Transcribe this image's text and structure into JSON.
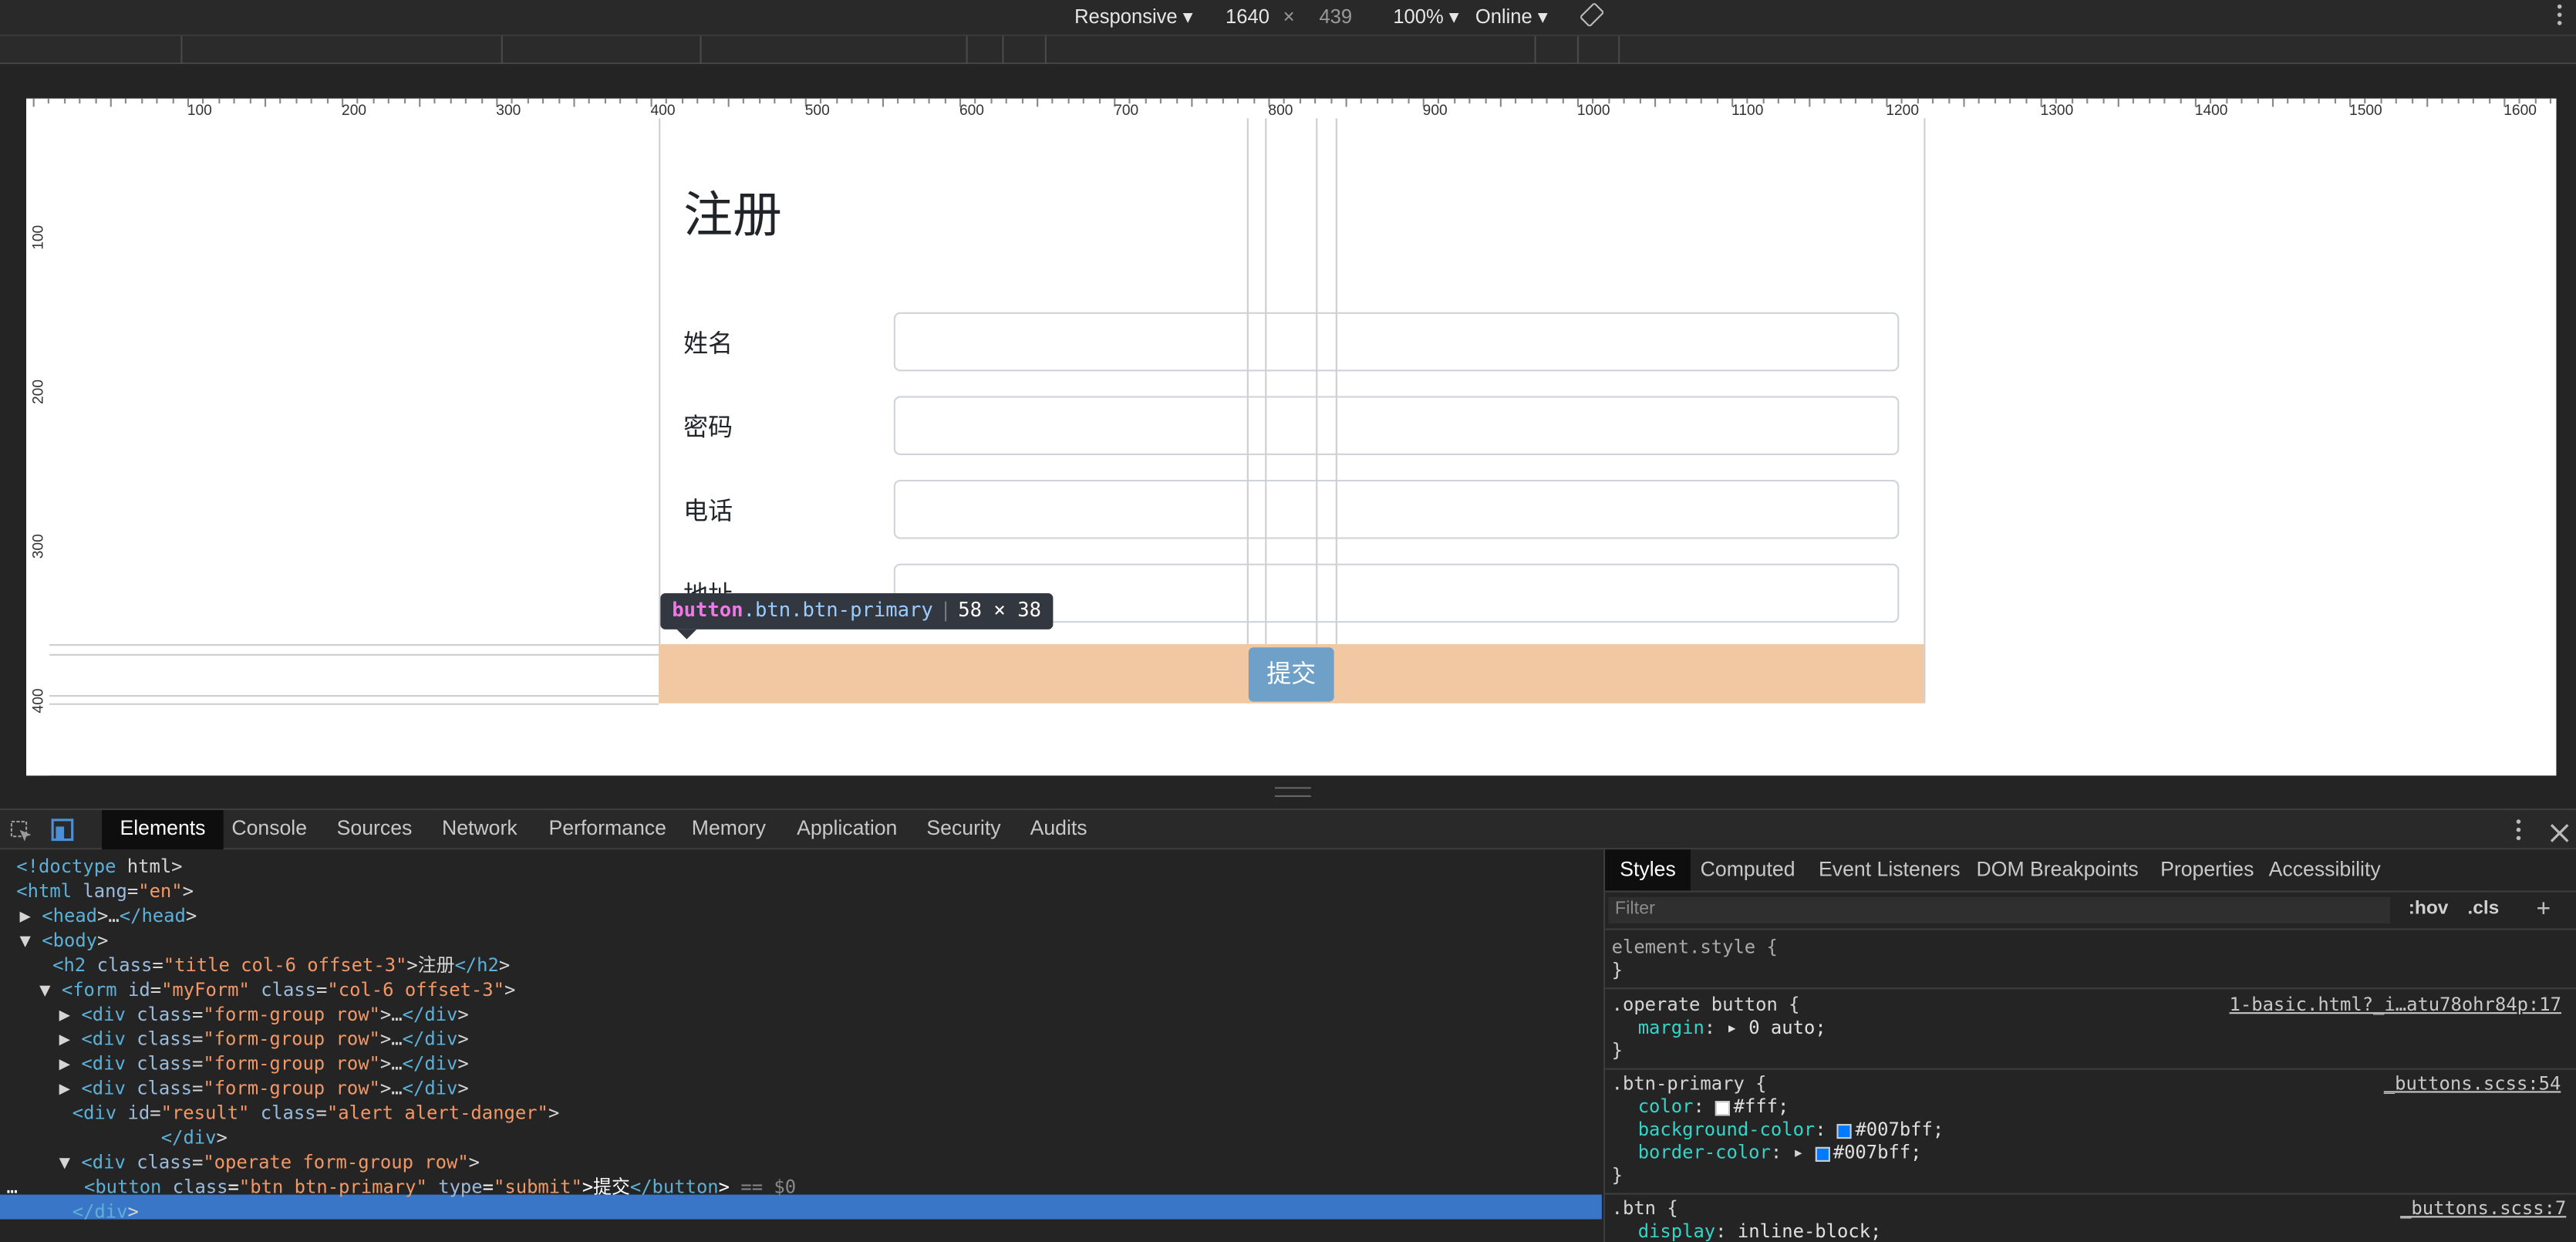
{
  "toolbar": {
    "device": "Responsive ▾",
    "width": "1640",
    "times": "×",
    "height": "439",
    "zoom": "100% ▾",
    "throttle": "Online ▾"
  },
  "ruler": {
    "h_labels": [
      "100",
      "200",
      "300",
      "400",
      "500",
      "600",
      "700",
      "800",
      "900",
      "1000",
      "1100",
      "1200",
      "1300",
      "1400",
      "1500",
      "1600"
    ],
    "v_labels": [
      "100",
      "200",
      "300",
      "400"
    ]
  },
  "page": {
    "title": "注册",
    "fields": [
      {
        "label": "姓名",
        "value": ""
      },
      {
        "label": "密码",
        "value": ""
      },
      {
        "label": "电话",
        "value": ""
      },
      {
        "label": "地址",
        "value": ""
      }
    ],
    "submit_label": "提交"
  },
  "tooltip": {
    "tag": "button",
    "classes": ".btn.btn-primary",
    "separator": "|",
    "size": "58 × 38"
  },
  "devtools": {
    "tabs": [
      "Elements",
      "Console",
      "Sources",
      "Network",
      "Performance",
      "Memory",
      "Application",
      "Security",
      "Audits"
    ],
    "active_tab": "Elements",
    "dom_lines": [
      {
        "ind": 10,
        "txt": "<!doctype html>",
        "cls": "tx"
      },
      {
        "ind": 10,
        "txt": "<html lang=\"en\">",
        "cls": "tg"
      },
      {
        "ind": 12,
        "txt": "▶ <head>…</head>",
        "cls": "tg"
      },
      {
        "ind": 12,
        "txt": "▼ <body>",
        "cls": "tg"
      },
      {
        "ind": 32,
        "txt": "<h2 class=\"title col-6 offset-3\">注册</h2>",
        "cls": "tg"
      },
      {
        "ind": 24,
        "txt": "▼ <form id=\"myForm\" class=\"col-6 offset-3\">",
        "cls": "tg"
      },
      {
        "ind": 36,
        "txt": "▶ <div class=\"form-group row\">…</div>",
        "cls": "tg"
      },
      {
        "ind": 36,
        "txt": "▶ <div class=\"form-group row\">…</div>",
        "cls": "tg"
      },
      {
        "ind": 36,
        "txt": "▶ <div class=\"form-group row\">…</div>",
        "cls": "tg"
      },
      {
        "ind": 36,
        "txt": "▶ <div class=\"form-group row\">…</div>",
        "cls": "tg"
      },
      {
        "ind": 44,
        "txt": "<div id=\"result\" class=\"alert alert-danger\">",
        "cls": "tg"
      },
      {
        "ind": 98,
        "txt": "</div>",
        "cls": "tg"
      },
      {
        "ind": 36,
        "txt": "▼ <div class=\"operate form-group row\">",
        "cls": "tg"
      },
      {
        "ind": 4,
        "txt": "…      <button class=\"btn btn-primary\" type=\"submit\">提交</button> == $0",
        "cls": "tx"
      },
      {
        "ind": 44,
        "txt": "</div>",
        "cls": "tg"
      }
    ],
    "styles_tabs": [
      "Styles",
      "Computed",
      "Event Listeners",
      "DOM Breakpoints",
      "Properties",
      "Accessibility"
    ],
    "filter_placeholder": "Filter",
    "hov": ":hov",
    "cls_btn": ".cls",
    "add": "+",
    "rules": {
      "element_style": "element.style {",
      "operate_sel": ".operate button {",
      "operate_src": "1-basic.html?_i…atu78ohr84p:17",
      "operate_prop": "margin",
      "operate_val": "▸ 0 auto;",
      "btnp_sel": ".btn-primary {",
      "btnp_src": "_buttons.scss:54",
      "color_prop": "color",
      "color_val": "#fff;",
      "bg_prop": "background-color",
      "bg_val": "#007bff;",
      "bc_prop": "border-color",
      "bc_val": "#007bff;",
      "btn_sel": ".btn {",
      "btn_src": "_buttons.scss:7",
      "display_prop": "display",
      "display_val": "inline-block;",
      "close": "}"
    },
    "colors": {
      "white": "#ffffff",
      "primary": "#007bff",
      "selection": "#3a76c8",
      "highlight": "#f1c8a1"
    }
  }
}
